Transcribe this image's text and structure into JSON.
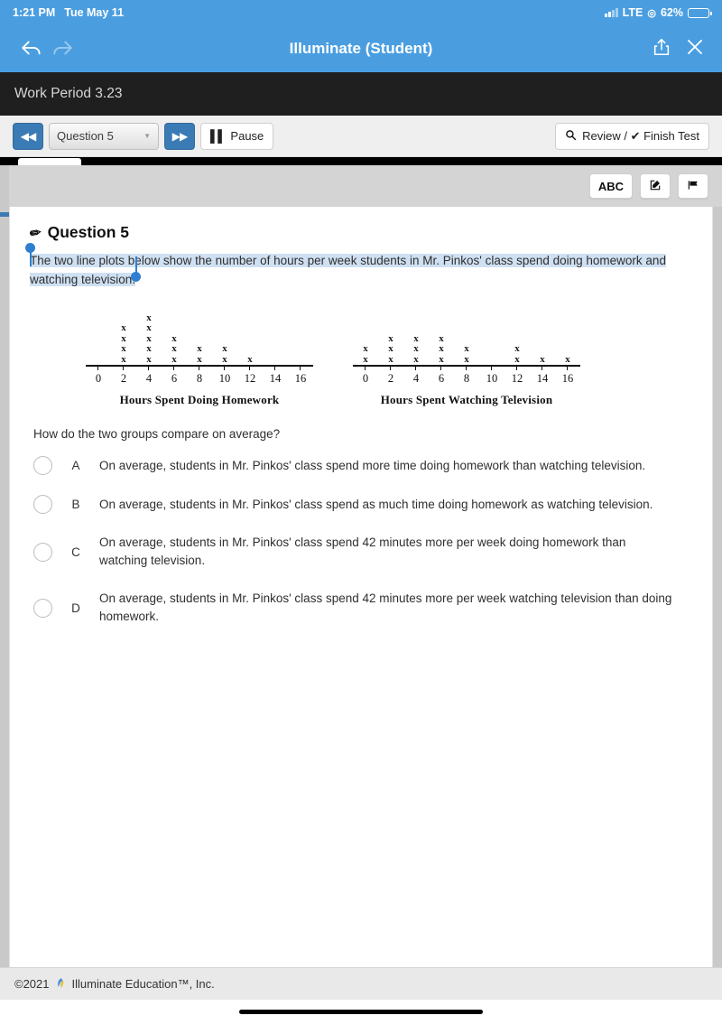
{
  "status_bar": {
    "time": "1:21 PM",
    "date": "Tue May 11",
    "carrier": "LTE",
    "battery_pct": "62%",
    "location_icon": "location-services-icon",
    "signal_icon": "signal-bars-icon",
    "battery_icon": "battery-icon"
  },
  "nav": {
    "title": "Illuminate (Student)",
    "back_icon": "back-arrow-icon",
    "forward_icon": "forward-arrow-icon",
    "share_icon": "share-icon",
    "close_icon": "close-x-icon"
  },
  "period": {
    "label": "Work Period 3.23"
  },
  "toolbar": {
    "prev_label": "◀◀",
    "next_label": "▶▶",
    "question_select_value": "Question 5",
    "caret_icon": "chevron-down-icon",
    "pause_label": "Pause",
    "pause_icon": "pause-icon",
    "review_finish_label": "Review / ✔ Finish Test",
    "review_icon": "magnifier-icon"
  },
  "question_tools": {
    "abc_label": "ABC",
    "annotate_icon": "✎",
    "flag_icon": "⚑"
  },
  "question": {
    "title": "Question 5",
    "pencil_icon": "pencil-icon",
    "stem": "The two line plots below show the number of hours per week students in Mr. Pinkos' class spend doing homework and watching television.",
    "prompt": "How do the two groups compare on average?",
    "choices": [
      {
        "letter": "A",
        "text": "On average, students in Mr. Pinkos' class spend more time doing homework than watching television.",
        "selected": false
      },
      {
        "letter": "B",
        "text": "On average, students in Mr. Pinkos' class spend as much time doing homework as watching television.",
        "selected": false
      },
      {
        "letter": "C",
        "text": "On average, students in Mr. Pinkos' class spend 42 minutes more per week doing homework than watching television.",
        "selected": false
      },
      {
        "letter": "D",
        "text": "On average, students in Mr. Pinkos' class spend 42 minutes more per week watching television than doing homework.",
        "selected": false
      }
    ]
  },
  "chart_data": [
    {
      "type": "dotplot",
      "title": "Hours Spent Doing Homework",
      "xlabel": "Hours Spent Doing Homework",
      "ylabel": "",
      "marker": "x",
      "categories": [
        0,
        2,
        4,
        6,
        8,
        10,
        12,
        14,
        16
      ],
      "values": [
        0,
        4,
        5,
        3,
        2,
        2,
        1,
        0,
        0
      ],
      "xlim": [
        0,
        16
      ],
      "grid": false,
      "legend": "none"
    },
    {
      "type": "dotplot",
      "title": "Hours Spent Watching Television",
      "xlabel": "Hours Spent Watching Television",
      "ylabel": "",
      "marker": "x",
      "categories": [
        0,
        2,
        4,
        6,
        8,
        10,
        12,
        14,
        16
      ],
      "values": [
        2,
        3,
        3,
        3,
        2,
        0,
        2,
        1,
        1
      ],
      "xlim": [
        0,
        16
      ],
      "grid": false,
      "legend": "none"
    }
  ],
  "footer": {
    "copyright": "©2021",
    "company": "Illuminate Education™, Inc.",
    "logo_icon": "illuminate-leaf-logo"
  },
  "colors": {
    "accent_blue": "#4a9ee0",
    "button_blue": "#3b7bb5",
    "dark_bar": "#1f1f1f",
    "highlight": "#cfe0f2",
    "handle": "#2f7fd0"
  }
}
